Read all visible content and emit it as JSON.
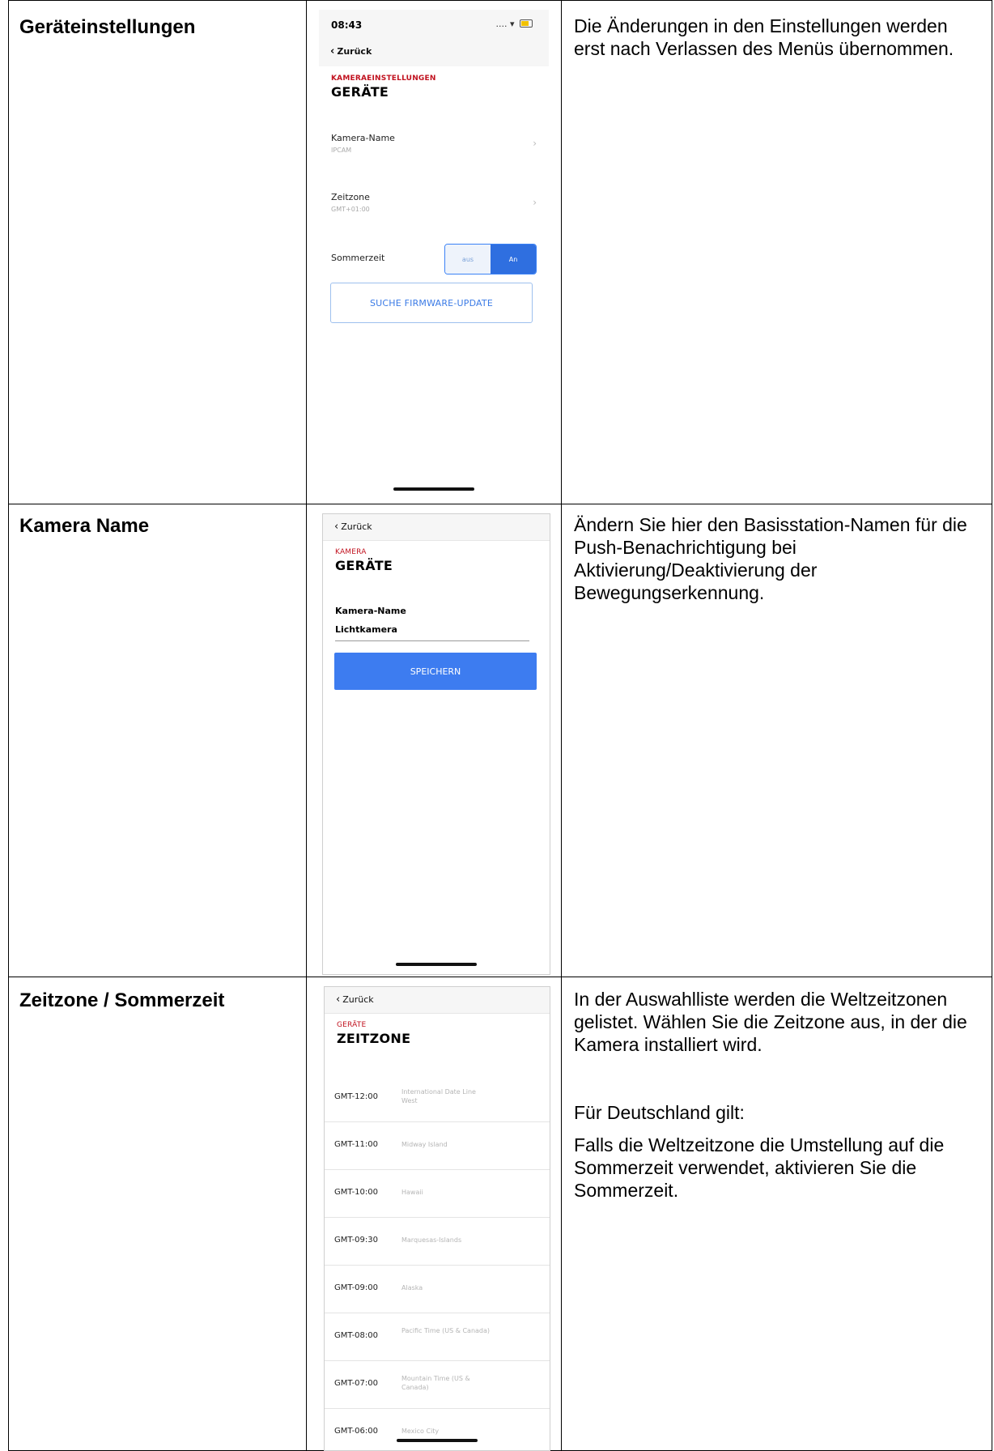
{
  "rows": [
    {
      "title": "Geräteinstellungen",
      "description": [
        "Die Änderungen in den Einstellungen werden erst nach Verlassen des Menüs übernommen."
      ],
      "screen": {
        "status_time": "08:43",
        "back_label": "Zurück",
        "kicker": "KAMERAEINSTELLUNGEN",
        "title": "GERÄTE",
        "settings": [
          {
            "label": "Kamera-Name",
            "value": "IPCAM"
          },
          {
            "label": "Zeitzone",
            "value": "GMT+01:00"
          }
        ],
        "dst_label": "Sommerzeit",
        "dst_options": [
          "aus",
          "An"
        ],
        "dst_selected": "An",
        "firmware_button": "SUCHE FIRMWARE-UPDATE"
      }
    },
    {
      "title": "Kamera Name",
      "description": [
        "Ändern Sie hier den Basisstation-Namen für die Push-Benachrichtigung bei Aktivierung/Deaktivierung der Bewegungserkennung."
      ],
      "screen": {
        "back_label": "Zurück",
        "kicker": "KAMERA",
        "title": "GERÄTE",
        "field_label": "Kamera-Name",
        "field_value": "Lichtkamera",
        "save_button": "SPEICHERN"
      }
    },
    {
      "title": "Zeitzone / Sommerzeit",
      "description": [
        "In der Auswahlliste werden die Weltzeitzonen gelistet. Wählen Sie die Zeitzone aus, in der die Kamera installiert wird.",
        "Für Deutschland gilt:",
        "Falls die Weltzeitzone die Umstellung auf die Sommerzeit verwendet, aktivieren Sie die Sommerzeit."
      ],
      "screen": {
        "back_label": "Zurück",
        "kicker": "GERÄTE",
        "title": "ZEITZONE",
        "timezones": [
          {
            "code": "GMT-12:00",
            "name": "International Date Line West"
          },
          {
            "code": "GMT-11:00",
            "name": "Midway Island"
          },
          {
            "code": "GMT-10:00",
            "name": "Hawaii"
          },
          {
            "code": "GMT-09:30",
            "name": "Marquesas-Islands"
          },
          {
            "code": "GMT-09:00",
            "name": "Alaska"
          },
          {
            "code": "GMT-08:00",
            "name": "Pacific Time (US & Canada)"
          },
          {
            "code": "GMT-07:00",
            "name": "Mountain Time (US & Canada)"
          },
          {
            "code": "GMT-06:00",
            "name": "Mexico City"
          }
        ]
      }
    }
  ]
}
